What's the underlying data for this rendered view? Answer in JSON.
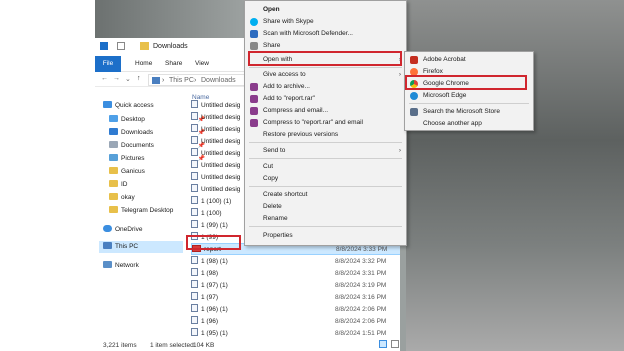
{
  "window": {
    "title": "Downloads"
  },
  "ribbon": {
    "tabs": [
      "File",
      "Home",
      "Share",
      "View"
    ]
  },
  "address": {
    "path": [
      "This PC",
      "Downloads"
    ]
  },
  "nav": {
    "items": [
      {
        "label": "Quick access"
      },
      {
        "label": "Desktop"
      },
      {
        "label": "Downloads"
      },
      {
        "label": "Documents"
      },
      {
        "label": "Pictures"
      },
      {
        "label": "Ganicus"
      },
      {
        "label": "ID"
      },
      {
        "label": "okay"
      },
      {
        "label": "Telegram Desktop"
      },
      {
        "label": "OneDrive"
      },
      {
        "label": "This PC"
      },
      {
        "label": "Network"
      }
    ]
  },
  "filelist": {
    "column_name": "Name",
    "rows": [
      {
        "name": "Untitled desig",
        "date": ""
      },
      {
        "name": "Untitled desig",
        "date": ""
      },
      {
        "name": "Untitled desig",
        "date": ""
      },
      {
        "name": "Untitled desig",
        "date": ""
      },
      {
        "name": "Untitled desig",
        "date": ""
      },
      {
        "name": "Untitled desig",
        "date": ""
      },
      {
        "name": "Untitled desig",
        "date": ""
      },
      {
        "name": "Untitled desig",
        "date": ""
      },
      {
        "name": "1 (100) (1)",
        "date": ""
      },
      {
        "name": "1 (100)",
        "date": ""
      },
      {
        "name": "1 (99) (1)",
        "date": ""
      },
      {
        "name": "1 (99)",
        "date": ""
      },
      {
        "name": "report",
        "date": "8/8/2024 3:33 PM"
      },
      {
        "name": "1 (98) (1)",
        "date": "8/8/2024 3:32 PM"
      },
      {
        "name": "1 (98)",
        "date": "8/8/2024 3:31 PM"
      },
      {
        "name": "1 (97) (1)",
        "date": "8/8/2024 3:19 PM"
      },
      {
        "name": "1 (97)",
        "date": "8/8/2024 3:16 PM"
      },
      {
        "name": "1 (96) (1)",
        "date": "8/8/2024 2:06 PM"
      },
      {
        "name": "1 (96)",
        "date": "8/8/2024 2:06 PM"
      },
      {
        "name": "1 (95) (1)",
        "date": "8/8/2024 1:51 PM"
      }
    ]
  },
  "status": {
    "items": "3,221 items",
    "selected": "1 item selected",
    "size": "104 KB"
  },
  "context_menu": {
    "items": [
      "Open",
      "Share with Skype",
      "Scan with Microsoft Defender...",
      "Share",
      "Open with",
      "Give access to",
      "Add to archive...",
      "Add to \"report.rar\"",
      "Compress and email...",
      "Compress to \"report.rar\" and email",
      "Restore previous versions",
      "Send to",
      "Cut",
      "Copy",
      "Create shortcut",
      "Delete",
      "Rename",
      "Properties"
    ]
  },
  "submenu": {
    "items": [
      "Adobe Acrobat",
      "Firefox",
      "Google Chrome",
      "Microsoft Edge",
      "Search the Microsoft Store",
      "Choose another app"
    ]
  },
  "colors": {
    "highlight_red": "#d0262e",
    "selection_blue": "#cce8ff",
    "file_tab_blue": "#1c6fc9"
  }
}
